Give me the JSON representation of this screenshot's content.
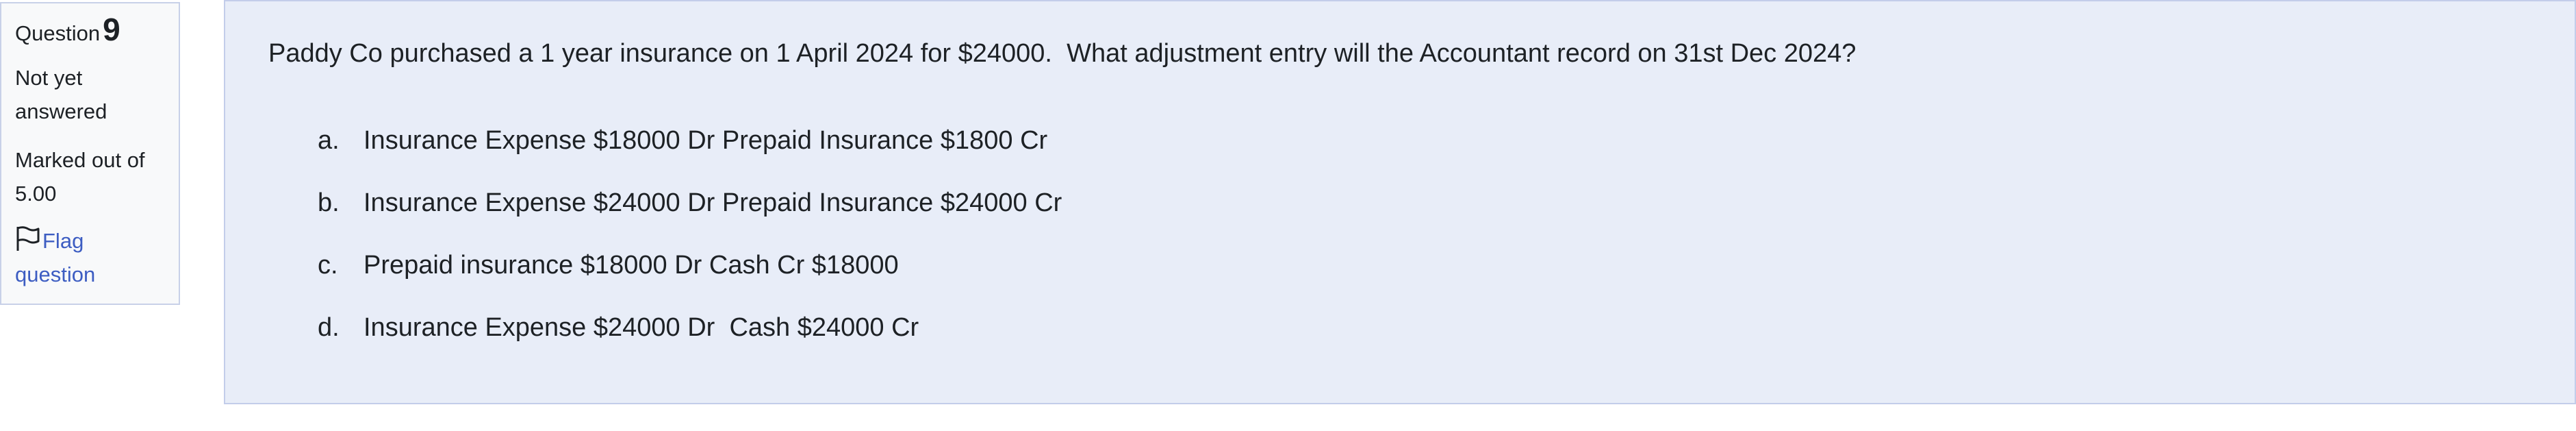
{
  "info": {
    "question_label": "Question",
    "question_number": "9",
    "state_line1": "Not yet",
    "state_line2": "answered",
    "grade_line1": "Marked out of",
    "grade_line2": "5.00",
    "flag_line1": "Flag",
    "flag_line2": "question",
    "flag_icon": "flag-icon"
  },
  "question": {
    "text": "Paddy Co purchased a 1 year insurance on 1 April 2024 for $24000.  What adjustment entry will the Accountant record on 31st Dec 2024?",
    "answers": [
      {
        "letter": "a.",
        "text": "Insurance Expense $18000 Dr Prepaid Insurance $1800 Cr"
      },
      {
        "letter": "b.",
        "text": "Insurance Expense $24000 Dr Prepaid Insurance $24000 Cr"
      },
      {
        "letter": "c.",
        "text": "Prepaid insurance $18000 Dr Cash Cr $18000"
      },
      {
        "letter": "d.",
        "text": "Insurance Expense $24000 Dr  Cash $24000 Cr"
      }
    ]
  },
  "colors": {
    "panel_bg": "#e8edf8",
    "info_bg": "#f8f9fa",
    "link": "#3d5dc2"
  }
}
